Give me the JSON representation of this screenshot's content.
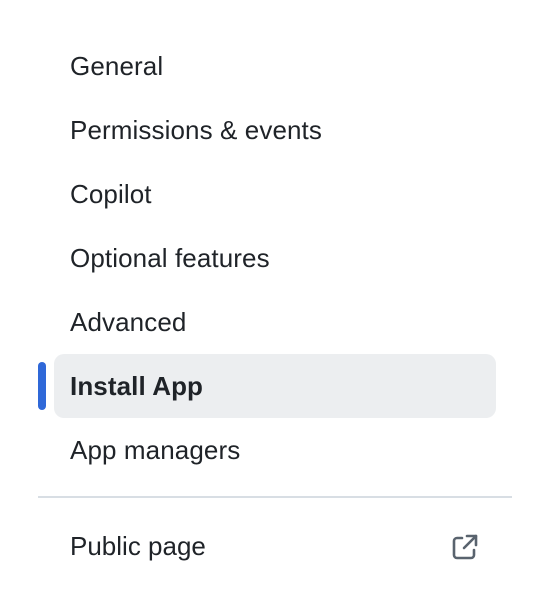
{
  "nav": {
    "items": [
      {
        "label": "General",
        "selected": false
      },
      {
        "label": "Permissions & events",
        "selected": false
      },
      {
        "label": "Copilot",
        "selected": false
      },
      {
        "label": "Optional features",
        "selected": false
      },
      {
        "label": "Advanced",
        "selected": false
      },
      {
        "label": "Install App",
        "selected": true
      },
      {
        "label": "App managers",
        "selected": false
      }
    ]
  },
  "footer": {
    "public_page_label": "Public page",
    "icon": "external-link-icon"
  },
  "colors": {
    "selected_indicator": "#2f68d8",
    "selected_background": "#eceef0",
    "divider": "#d8dee4",
    "text": "#1f2328",
    "icon": "#59636e"
  }
}
